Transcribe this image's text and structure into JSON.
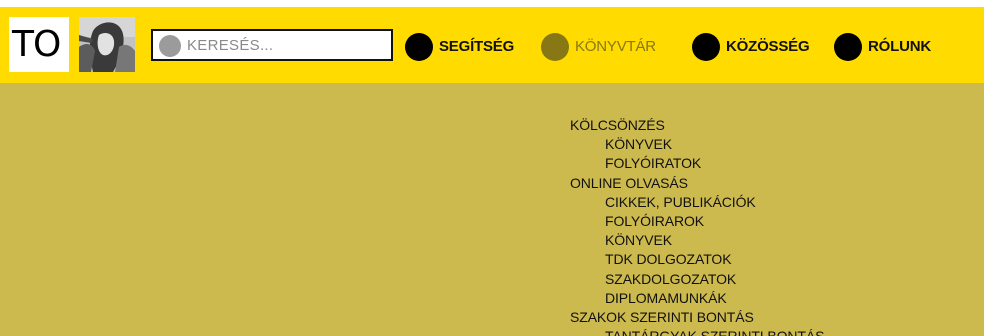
{
  "header": {
    "logo_text": "TO",
    "search": {
      "placeholder": "KERESÉS..."
    },
    "nav": [
      {
        "label": "SEGÍTSÉG",
        "active": false
      },
      {
        "label": "KÖNYVTÁR",
        "active": true
      },
      {
        "label": "KÖZÖSSÉG",
        "active": false
      },
      {
        "label": "RÓLUNK",
        "active": false
      }
    ]
  },
  "dropdown": {
    "items": [
      {
        "label": "KÖLCSÖNZÉS",
        "level": 0
      },
      {
        "label": "KÖNYVEK",
        "level": 1
      },
      {
        "label": "FOLYÓIRATOK",
        "level": 1
      },
      {
        "label": "ONLINE OLVASÁS",
        "level": 0
      },
      {
        "label": "CIKKEK, PUBLIKÁCIÓK",
        "level": 1
      },
      {
        "label": "FOLYÓIRAROK",
        "level": 1
      },
      {
        "label": "KÖNYVEK",
        "level": 1
      },
      {
        "label": "TDK DOLGOZATOK",
        "level": 1
      },
      {
        "label": "SZAKDOLGOZATOK",
        "level": 1
      },
      {
        "label": "DIPLOMAMUNKÁK",
        "level": 1
      },
      {
        "label": "SZAKOK SZERINTI BONTÁS",
        "level": 0
      },
      {
        "label": "TANTÁRGYAK SZERINTI BONTÁS",
        "level": 1
      }
    ]
  },
  "colors": {
    "header_bg": "#ffdb00",
    "content_bg": "#cdba4e",
    "active_nav": "#877815"
  }
}
